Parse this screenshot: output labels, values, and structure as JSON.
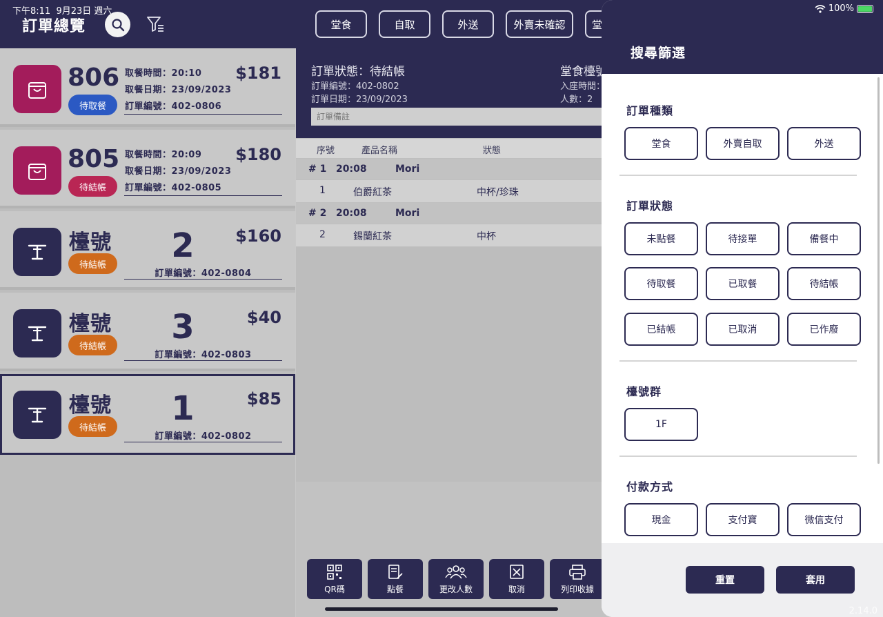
{
  "status_bar": {
    "time": "下午8:11",
    "date": "9月23日 週六",
    "battery": "100%"
  },
  "header": {
    "title": "訂單總覽",
    "tabs": [
      "堂食",
      "自取",
      "外送",
      "外賣未確認",
      "堂"
    ]
  },
  "orders": [
    {
      "type": "takeout",
      "number": "806",
      "status": "待取餐",
      "status_color": "#2b59c3",
      "time_label": "取餐時間：20:10",
      "date_label": "取餐日期：23/09/2023",
      "order_no": "訂單編號：402-0806",
      "price": "$181"
    },
    {
      "type": "takeout",
      "number": "805",
      "status": "待結帳",
      "status_color": "#b92654",
      "time_label": "取餐時間：20:09",
      "date_label": "取餐日期：23/09/2023",
      "order_no": "訂單編號：402-0805",
      "price": "$180"
    },
    {
      "type": "table",
      "label": "檯號",
      "number": "2",
      "status": "待結帳",
      "status_color": "#cf6a1c",
      "order_no": "訂單編號：402-0804",
      "price": "$160"
    },
    {
      "type": "table",
      "label": "檯號",
      "number": "3",
      "status": "待結帳",
      "status_color": "#cf6a1c",
      "order_no": "訂單編號：402-0803",
      "price": "$40"
    },
    {
      "type": "table",
      "label": "檯號",
      "number": "1",
      "status": "待結帳",
      "status_color": "#cf6a1c",
      "order_no": "訂單編號：402-0802",
      "price": "$85",
      "selected": true
    }
  ],
  "detail": {
    "status": "訂單狀態：待結帳",
    "order_no": "訂單編號：402-0802",
    "order_date": "訂單日期：23/09/2023",
    "right_title": "堂食檯號",
    "seat_time": "入座時間：",
    "people": "人數：2",
    "note_placeholder": "訂單備註",
    "columns": [
      "序號",
      "產品名稱",
      "狀態"
    ],
    "groups": [
      {
        "index": "# 1",
        "time": "20:08",
        "staff": "Mori",
        "items": [
          {
            "seq": "1",
            "name": "伯爵紅茶",
            "status": "中杯/珍珠"
          }
        ]
      },
      {
        "index": "# 2",
        "time": "20:08",
        "staff": "Mori",
        "items": [
          {
            "seq": "2",
            "name": "錫蘭紅茶",
            "status": "中杯"
          }
        ]
      }
    ],
    "actions": [
      "QR碼",
      "點餐",
      "更改人數",
      "取消",
      "列印收據"
    ]
  },
  "filter": {
    "title": "搜尋篩選",
    "sections": [
      {
        "title": "訂單種類",
        "options": [
          "堂食",
          "外賣自取",
          "外送"
        ]
      },
      {
        "title": "訂單狀態",
        "options": [
          "未點餐",
          "待接單",
          "備餐中",
          "待取餐",
          "已取餐",
          "待結帳",
          "已結帳",
          "已取消",
          "已作廢"
        ]
      },
      {
        "title": "檯號群",
        "options": [
          "1F"
        ]
      },
      {
        "title": "付款方式",
        "options": [
          "現金",
          "支付寶",
          "微信支付"
        ]
      }
    ],
    "reset_label": "重置",
    "apply_label": "套用"
  },
  "version": "2.14.0",
  "colors": {
    "primary": "#2c2a52",
    "takeout": "#a31c5b",
    "pending_pickup": "#2b59c3",
    "pending_checkout_takeout": "#b92654",
    "pending_checkout_table": "#cf6a1c"
  }
}
